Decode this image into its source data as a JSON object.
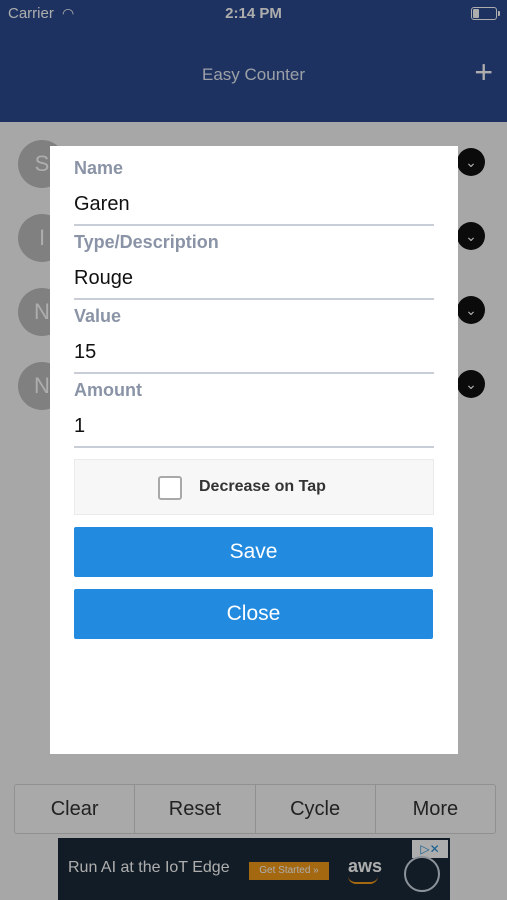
{
  "status": {
    "carrier": "Carrier",
    "time": "2:14 PM"
  },
  "nav": {
    "title": "Easy Counter",
    "add_icon": "+"
  },
  "list": {
    "avatars": [
      "S",
      "I",
      "N",
      "N"
    ]
  },
  "toolbar": {
    "clear": "Clear",
    "reset": "Reset",
    "cycle": "Cycle",
    "more": "More"
  },
  "ad": {
    "text": "Run AI at the IoT Edge",
    "cta": "Get Started »",
    "brand": "aws"
  },
  "modal": {
    "name_label": "Name",
    "name_value": "Garen",
    "type_label": "Type/Description",
    "type_value": "Rouge",
    "value_label": "Value",
    "value_value": "15",
    "amount_label": "Amount",
    "amount_value": "1",
    "decrease_label": "Decrease on Tap",
    "save_label": "Save",
    "close_label": "Close"
  }
}
